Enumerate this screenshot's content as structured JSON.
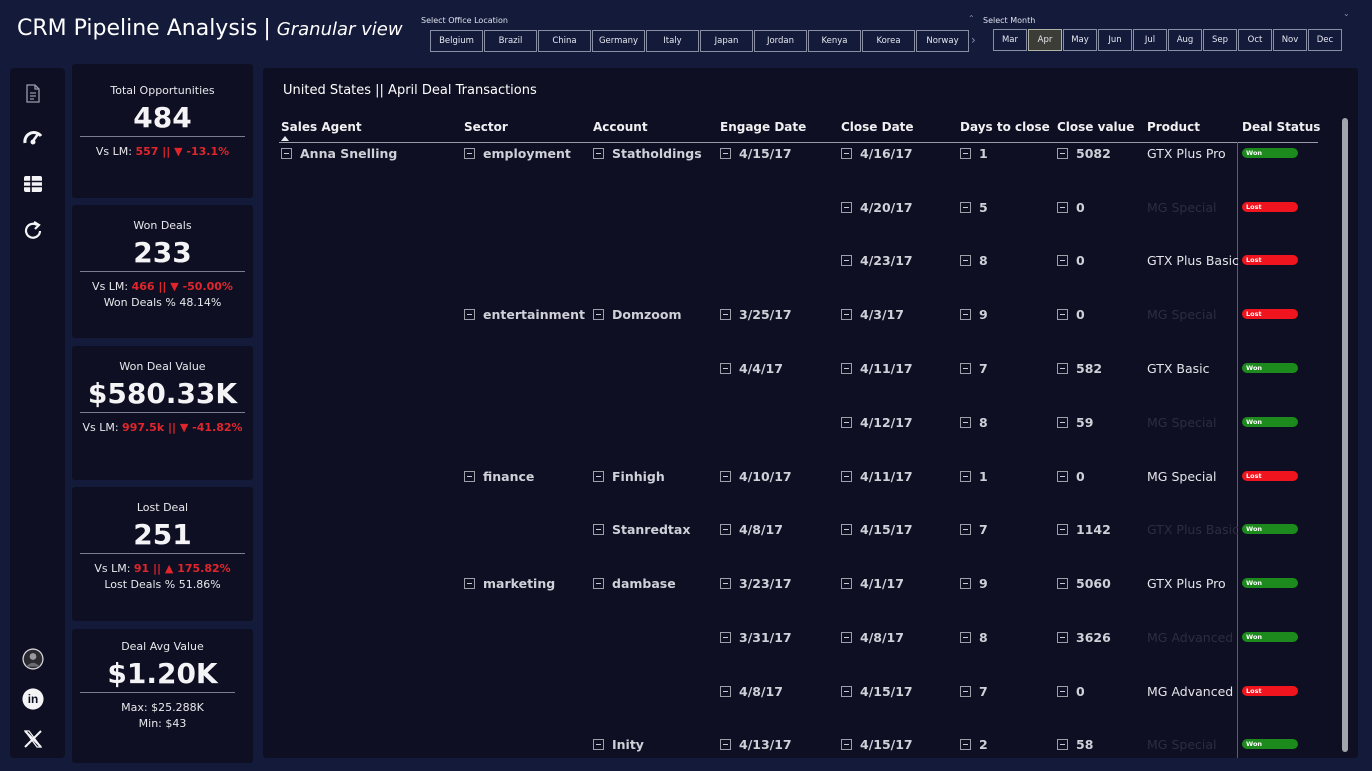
{
  "header": {
    "title": "CRM Pipeline Analysis",
    "separator": "|",
    "subtitle": "Granular view"
  },
  "office_slicer": {
    "label": "Select Office Location",
    "options": [
      "Belgium",
      "Brazil",
      "China",
      "Germany",
      "Italy",
      "Japan",
      "Jordan",
      "Kenya",
      "Korea",
      "Norway"
    ]
  },
  "month_slicer": {
    "label": "Select Month",
    "options": [
      "Mar",
      "Apr",
      "May",
      "Jun",
      "Jul",
      "Aug",
      "Sep",
      "Oct",
      "Nov",
      "Dec"
    ],
    "selected": "Apr"
  },
  "sidebar": {
    "icons": [
      "document-icon",
      "gauge-icon",
      "table-icon",
      "refresh-icon",
      "avatar",
      "linkedin-icon",
      "x-twitter-icon"
    ],
    "linkedin_text": "in"
  },
  "kpis": {
    "total": {
      "title": "Total Opportunities",
      "value": "484",
      "vs_prefix": "Vs LM:",
      "vs_value": "557 || ▼ -13.1%"
    },
    "won": {
      "title": "Won Deals",
      "value": "233",
      "vs_prefix": "Vs LM:",
      "vs_value": "466 || ▼ -50.00%",
      "extra": "Won Deals % 48.14%"
    },
    "won_value": {
      "title": "Won Deal Value",
      "value": "$580.33K",
      "vs_prefix": "Vs LM:",
      "vs_value": "997.5k || ▼ -41.82%"
    },
    "lost": {
      "title": "Lost Deal",
      "value": "251",
      "vs_prefix": "Vs LM:",
      "vs_value": "91 || ▲ 175.82%",
      "extra": "Lost Deals % 51.86%"
    },
    "avg": {
      "title": "Deal Avg Value",
      "value": "$1.20K",
      "max": "Max: $25.288K",
      "min": "Min: $43"
    }
  },
  "table": {
    "title": "United States || April  Deal Transactions",
    "columns": [
      "Sales Agent",
      "Sector",
      "Account",
      "Engage Date",
      "Close Date",
      "Days to close",
      "Close value",
      "Product",
      "Deal Status"
    ],
    "agent": "Anna Snelling",
    "rows": [
      {
        "sector": "employment",
        "account": "Statholdings",
        "engage": "4/15/17",
        "close": "4/16/17",
        "days": "1",
        "value": "5082",
        "product": "GTX Plus Pro",
        "product_dim": false,
        "status": "Won"
      },
      {
        "sector": "",
        "account": "",
        "engage": "",
        "close": "4/20/17",
        "days": "5",
        "value": "0",
        "product": "MG Special",
        "product_dim": true,
        "status": "Lost"
      },
      {
        "sector": "",
        "account": "",
        "engage": "",
        "close": "4/23/17",
        "days": "8",
        "value": "0",
        "product": "GTX Plus Basic",
        "product_dim": false,
        "status": "Lost"
      },
      {
        "sector": "entertainment",
        "account": "Domzoom",
        "engage": "3/25/17",
        "close": "4/3/17",
        "days": "9",
        "value": "0",
        "product": "MG Special",
        "product_dim": true,
        "status": "Lost"
      },
      {
        "sector": "",
        "account": "",
        "engage": "4/4/17",
        "close": "4/11/17",
        "days": "7",
        "value": "582",
        "product": "GTX Basic",
        "product_dim": false,
        "status": "Won"
      },
      {
        "sector": "",
        "account": "",
        "engage": "",
        "close": "4/12/17",
        "days": "8",
        "value": "59",
        "product": "MG Special",
        "product_dim": true,
        "status": "Won"
      },
      {
        "sector": "finance",
        "account": "Finhigh",
        "engage": "4/10/17",
        "close": "4/11/17",
        "days": "1",
        "value": "0",
        "product": "MG Special",
        "product_dim": false,
        "status": "Lost"
      },
      {
        "sector": "",
        "account": "Stanredtax",
        "engage": "4/8/17",
        "close": "4/15/17",
        "days": "7",
        "value": "1142",
        "product": "GTX Plus Basic",
        "product_dim": true,
        "status": "Won"
      },
      {
        "sector": "marketing",
        "account": "dambase",
        "engage": "3/23/17",
        "close": "4/1/17",
        "days": "9",
        "value": "5060",
        "product": "GTX Plus Pro",
        "product_dim": false,
        "status": "Won"
      },
      {
        "sector": "",
        "account": "",
        "engage": "3/31/17",
        "close": "4/8/17",
        "days": "8",
        "value": "3626",
        "product": "MG Advanced",
        "product_dim": true,
        "status": "Won"
      },
      {
        "sector": "",
        "account": "",
        "engage": "4/8/17",
        "close": "4/15/17",
        "days": "7",
        "value": "0",
        "product": "MG Advanced",
        "product_dim": false,
        "status": "Lost"
      },
      {
        "sector": "",
        "account": "Inity",
        "engage": "4/13/17",
        "close": "4/15/17",
        "days": "2",
        "value": "58",
        "product": "MG Special",
        "product_dim": true,
        "status": "Won"
      }
    ]
  },
  "colors": {
    "background": "#141a3a",
    "panel": "#0e0f22",
    "negative": "#e0262c",
    "won": "#1c8a1c",
    "lost": "#f0141e"
  }
}
